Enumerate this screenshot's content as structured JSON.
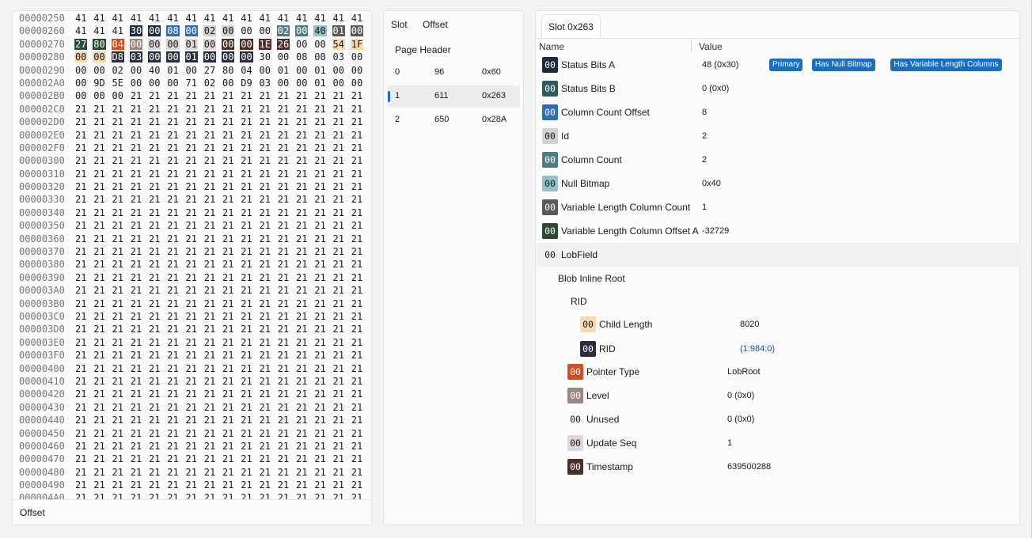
{
  "hex": {
    "lines": [
      {
        "offset": "00000250",
        "bytes": [
          "41",
          "41",
          "41",
          "41",
          "41",
          "41",
          "41",
          "41",
          "41",
          "41",
          "41",
          "41",
          "41",
          "41",
          "41",
          "41"
        ]
      },
      {
        "offset": "00000260",
        "bytes": [
          "41",
          "41",
          "41",
          "30",
          "00",
          "08",
          "00",
          "02",
          "00",
          "00",
          "00",
          "02",
          "00",
          "40",
          "01",
          "00"
        ],
        "colors": [
          null,
          null,
          null,
          "#1e2a3e",
          "#1e2a3e",
          "#2e6fb4",
          "#2e6fb4",
          "#d2d2d2",
          "#d2d2d2",
          null,
          null,
          "#4d7d82",
          "#4d7d82",
          "#93c2cc",
          "#5a5a5a",
          "#5a5a5a"
        ]
      },
      {
        "offset": "00000270",
        "bytes": [
          "27",
          "80",
          "04",
          "00",
          "00",
          "00",
          "01",
          "00",
          "00",
          "00",
          "1E",
          "26",
          "00",
          "00",
          "54",
          "1F"
        ],
        "colors": [
          "#2a4a32",
          "#2a4a32",
          "#d2501e",
          "#9c8680",
          "#e0d8d6",
          "#e0d8d6",
          "#e0d8d6",
          "#e0d8d6",
          "#4a2e28",
          "#4a2e28",
          "#4a2e28",
          "#4a2e28",
          null,
          null,
          "#f8dcb0",
          "#f8dcb0"
        ]
      },
      {
        "offset": "00000280",
        "bytes": [
          "00",
          "00",
          "D8",
          "03",
          "00",
          "00",
          "01",
          "00",
          "00",
          "00",
          "30",
          "00",
          "08",
          "00",
          "03",
          "00"
        ],
        "colors": [
          "#f8dcb0",
          "#f8dcb0",
          "#2a2e3c",
          "#2a2e3c",
          "#2a2e3c",
          "#2a2e3c",
          "#2a2e3c",
          "#2a2e3c",
          "#2a2e3c",
          "#2a2e3c",
          null,
          null,
          null,
          null,
          null,
          null
        ]
      },
      {
        "offset": "00000290",
        "bytes": [
          "00",
          "00",
          "02",
          "00",
          "40",
          "01",
          "00",
          "27",
          "80",
          "04",
          "00",
          "01",
          "00",
          "01",
          "00",
          "00"
        ]
      },
      {
        "offset": "000002A0",
        "bytes": [
          "00",
          "9D",
          "5E",
          "00",
          "00",
          "00",
          "71",
          "02",
          "00",
          "D9",
          "03",
          "00",
          "00",
          "01",
          "00",
          "00"
        ]
      },
      {
        "offset": "000002B0",
        "bytes": [
          "00",
          "00",
          "00",
          "21",
          "21",
          "21",
          "21",
          "21",
          "21",
          "21",
          "21",
          "21",
          "21",
          "21",
          "21",
          "21"
        ]
      },
      {
        "offset": "000002C0",
        "bytes": [
          "21",
          "21",
          "21",
          "21",
          "21",
          "21",
          "21",
          "21",
          "21",
          "21",
          "21",
          "21",
          "21",
          "21",
          "21",
          "21"
        ]
      },
      {
        "offset": "000002D0",
        "bytes": [
          "21",
          "21",
          "21",
          "21",
          "21",
          "21",
          "21",
          "21",
          "21",
          "21",
          "21",
          "21",
          "21",
          "21",
          "21",
          "21"
        ]
      },
      {
        "offset": "000002E0",
        "bytes": [
          "21",
          "21",
          "21",
          "21",
          "21",
          "21",
          "21",
          "21",
          "21",
          "21",
          "21",
          "21",
          "21",
          "21",
          "21",
          "21"
        ]
      },
      {
        "offset": "000002F0",
        "bytes": [
          "21",
          "21",
          "21",
          "21",
          "21",
          "21",
          "21",
          "21",
          "21",
          "21",
          "21",
          "21",
          "21",
          "21",
          "21",
          "21"
        ]
      },
      {
        "offset": "00000300",
        "bytes": [
          "21",
          "21",
          "21",
          "21",
          "21",
          "21",
          "21",
          "21",
          "21",
          "21",
          "21",
          "21",
          "21",
          "21",
          "21",
          "21"
        ]
      },
      {
        "offset": "00000310",
        "bytes": [
          "21",
          "21",
          "21",
          "21",
          "21",
          "21",
          "21",
          "21",
          "21",
          "21",
          "21",
          "21",
          "21",
          "21",
          "21",
          "21"
        ]
      },
      {
        "offset": "00000320",
        "bytes": [
          "21",
          "21",
          "21",
          "21",
          "21",
          "21",
          "21",
          "21",
          "21",
          "21",
          "21",
          "21",
          "21",
          "21",
          "21",
          "21"
        ]
      },
      {
        "offset": "00000330",
        "bytes": [
          "21",
          "21",
          "21",
          "21",
          "21",
          "21",
          "21",
          "21",
          "21",
          "21",
          "21",
          "21",
          "21",
          "21",
          "21",
          "21"
        ]
      },
      {
        "offset": "00000340",
        "bytes": [
          "21",
          "21",
          "21",
          "21",
          "21",
          "21",
          "21",
          "21",
          "21",
          "21",
          "21",
          "21",
          "21",
          "21",
          "21",
          "21"
        ]
      },
      {
        "offset": "00000350",
        "bytes": [
          "21",
          "21",
          "21",
          "21",
          "21",
          "21",
          "21",
          "21",
          "21",
          "21",
          "21",
          "21",
          "21",
          "21",
          "21",
          "21"
        ]
      },
      {
        "offset": "00000360",
        "bytes": [
          "21",
          "21",
          "21",
          "21",
          "21",
          "21",
          "21",
          "21",
          "21",
          "21",
          "21",
          "21",
          "21",
          "21",
          "21",
          "21"
        ]
      },
      {
        "offset": "00000370",
        "bytes": [
          "21",
          "21",
          "21",
          "21",
          "21",
          "21",
          "21",
          "21",
          "21",
          "21",
          "21",
          "21",
          "21",
          "21",
          "21",
          "21"
        ]
      },
      {
        "offset": "00000380",
        "bytes": [
          "21",
          "21",
          "21",
          "21",
          "21",
          "21",
          "21",
          "21",
          "21",
          "21",
          "21",
          "21",
          "21",
          "21",
          "21",
          "21"
        ]
      },
      {
        "offset": "00000390",
        "bytes": [
          "21",
          "21",
          "21",
          "21",
          "21",
          "21",
          "21",
          "21",
          "21",
          "21",
          "21",
          "21",
          "21",
          "21",
          "21",
          "21"
        ]
      },
      {
        "offset": "000003A0",
        "bytes": [
          "21",
          "21",
          "21",
          "21",
          "21",
          "21",
          "21",
          "21",
          "21",
          "21",
          "21",
          "21",
          "21",
          "21",
          "21",
          "21"
        ]
      },
      {
        "offset": "000003B0",
        "bytes": [
          "21",
          "21",
          "21",
          "21",
          "21",
          "21",
          "21",
          "21",
          "21",
          "21",
          "21",
          "21",
          "21",
          "21",
          "21",
          "21"
        ]
      },
      {
        "offset": "000003C0",
        "bytes": [
          "21",
          "21",
          "21",
          "21",
          "21",
          "21",
          "21",
          "21",
          "21",
          "21",
          "21",
          "21",
          "21",
          "21",
          "21",
          "21"
        ]
      },
      {
        "offset": "000003D0",
        "bytes": [
          "21",
          "21",
          "21",
          "21",
          "21",
          "21",
          "21",
          "21",
          "21",
          "21",
          "21",
          "21",
          "21",
          "21",
          "21",
          "21"
        ]
      },
      {
        "offset": "000003E0",
        "bytes": [
          "21",
          "21",
          "21",
          "21",
          "21",
          "21",
          "21",
          "21",
          "21",
          "21",
          "21",
          "21",
          "21",
          "21",
          "21",
          "21"
        ]
      },
      {
        "offset": "000003F0",
        "bytes": [
          "21",
          "21",
          "21",
          "21",
          "21",
          "21",
          "21",
          "21",
          "21",
          "21",
          "21",
          "21",
          "21",
          "21",
          "21",
          "21"
        ]
      },
      {
        "offset": "00000400",
        "bytes": [
          "21",
          "21",
          "21",
          "21",
          "21",
          "21",
          "21",
          "21",
          "21",
          "21",
          "21",
          "21",
          "21",
          "21",
          "21",
          "21"
        ]
      },
      {
        "offset": "00000410",
        "bytes": [
          "21",
          "21",
          "21",
          "21",
          "21",
          "21",
          "21",
          "21",
          "21",
          "21",
          "21",
          "21",
          "21",
          "21",
          "21",
          "21"
        ]
      },
      {
        "offset": "00000420",
        "bytes": [
          "21",
          "21",
          "21",
          "21",
          "21",
          "21",
          "21",
          "21",
          "21",
          "21",
          "21",
          "21",
          "21",
          "21",
          "21",
          "21"
        ]
      },
      {
        "offset": "00000430",
        "bytes": [
          "21",
          "21",
          "21",
          "21",
          "21",
          "21",
          "21",
          "21",
          "21",
          "21",
          "21",
          "21",
          "21",
          "21",
          "21",
          "21"
        ]
      },
      {
        "offset": "00000440",
        "bytes": [
          "21",
          "21",
          "21",
          "21",
          "21",
          "21",
          "21",
          "21",
          "21",
          "21",
          "21",
          "21",
          "21",
          "21",
          "21",
          "21"
        ]
      },
      {
        "offset": "00000450",
        "bytes": [
          "21",
          "21",
          "21",
          "21",
          "21",
          "21",
          "21",
          "21",
          "21",
          "21",
          "21",
          "21",
          "21",
          "21",
          "21",
          "21"
        ]
      },
      {
        "offset": "00000460",
        "bytes": [
          "21",
          "21",
          "21",
          "21",
          "21",
          "21",
          "21",
          "21",
          "21",
          "21",
          "21",
          "21",
          "21",
          "21",
          "21",
          "21"
        ]
      },
      {
        "offset": "00000470",
        "bytes": [
          "21",
          "21",
          "21",
          "21",
          "21",
          "21",
          "21",
          "21",
          "21",
          "21",
          "21",
          "21",
          "21",
          "21",
          "21",
          "21"
        ]
      },
      {
        "offset": "00000480",
        "bytes": [
          "21",
          "21",
          "21",
          "21",
          "21",
          "21",
          "21",
          "21",
          "21",
          "21",
          "21",
          "21",
          "21",
          "21",
          "21",
          "21"
        ]
      },
      {
        "offset": "00000490",
        "bytes": [
          "21",
          "21",
          "21",
          "21",
          "21",
          "21",
          "21",
          "21",
          "21",
          "21",
          "21",
          "21",
          "21",
          "21",
          "21",
          "21"
        ]
      },
      {
        "offset": "000004A0",
        "bytes": [
          "21",
          "21",
          "21",
          "21",
          "21",
          "21",
          "21",
          "21",
          "21",
          "21",
          "21",
          "21",
          "21",
          "21",
          "21",
          "21"
        ]
      }
    ],
    "footer": "Offset"
  },
  "slots": {
    "header_slot": "Slot",
    "header_offset": "Offset",
    "page_header": "Page Header",
    "rows": [
      {
        "slot": "0",
        "offset": "96",
        "hex": "0x60"
      },
      {
        "slot": "1",
        "offset": "611",
        "hex": "0x263"
      },
      {
        "slot": "2",
        "offset": "650",
        "hex": "0x28A"
      }
    ]
  },
  "detail": {
    "tab": "Slot 0x263",
    "col_name": "Name",
    "col_value": "Value",
    "chip_text": "00",
    "fields": [
      {
        "label": "Status Bits A",
        "value": "48 (0x30)",
        "color": "#1e2a3e"
      },
      {
        "label": "Status Bits B",
        "value": "0 (0x0)",
        "color": "#2f5a5a"
      },
      {
        "label": "Column Count Offset",
        "value": "8",
        "color": "#2e6fb4"
      },
      {
        "label": "Id",
        "value": "2",
        "color": "#d2d2d2"
      },
      {
        "label": "Column Count",
        "value": "2",
        "color": "#4d7d82"
      },
      {
        "label": "Null Bitmap",
        "value": "0x40",
        "color": "#93c2cc"
      },
      {
        "label": "Variable Length Column Count",
        "value": "1",
        "color": "#5a5a5a"
      },
      {
        "label": "Variable Length Column Offset A",
        "value": "-32729",
        "color": "#2a4a32"
      }
    ],
    "badges": [
      "Primary",
      "Has Null Bitmap",
      "Has Variable Length Columns"
    ],
    "lob": {
      "label": "LobField",
      "blob_root": "Blob Inline Root",
      "rid_group": "RID",
      "rid_fields": [
        {
          "label": "Child Length",
          "value": "8020",
          "color": "#f8dcb0"
        },
        {
          "label": "RID",
          "value": "(1:984:0)",
          "color": "#2a2e3c"
        }
      ],
      "fields": [
        {
          "label": "Pointer Type",
          "value": "LobRoot",
          "color": "#d2501e"
        },
        {
          "label": "Level",
          "value": "0 (0x0)",
          "color": "#9c8680"
        },
        {
          "label": "Unused",
          "value": "0 (0x0)",
          "color": ""
        },
        {
          "label": "Update Seq",
          "value": "1",
          "color": "#e0d8d6"
        },
        {
          "label": "Timestamp",
          "value": "639500288",
          "color": "#4a2e28"
        }
      ]
    }
  }
}
